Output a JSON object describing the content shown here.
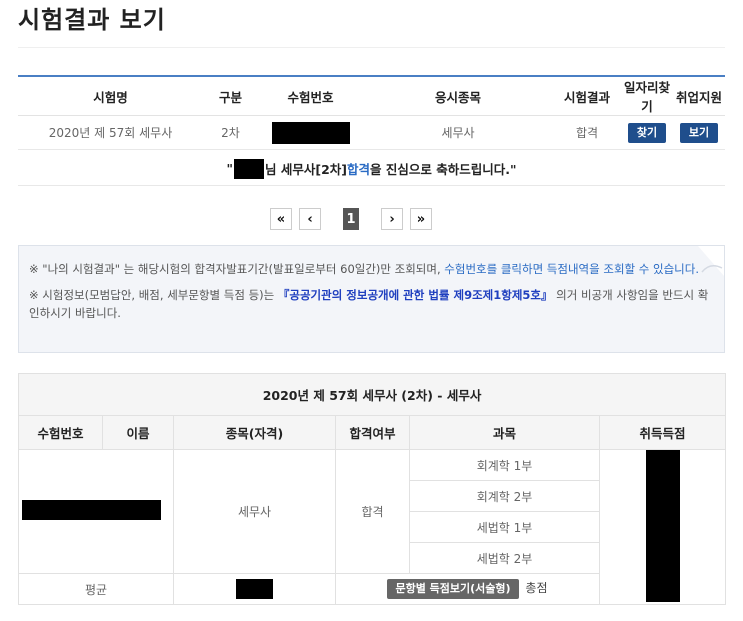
{
  "page": {
    "title": "시험결과 보기"
  },
  "results": {
    "columns": [
      "시험명",
      "구분",
      "수험번호",
      "응시종목",
      "시험결과",
      "일자리찾기",
      "취업지원"
    ],
    "row": {
      "exam_name": "2020년 제 57회 세무사",
      "stage": "2차",
      "category": "세무사",
      "result": "합격",
      "job_search_btn": "찾기",
      "employment_btn": "보기"
    },
    "congrats": {
      "quote_open": "\"",
      "suffix_a": "님 세무사[2차] ",
      "pass_word": "합격",
      "suffix_b": "을 진심으로 축하드립니다.\""
    }
  },
  "pagination": {
    "first": "«",
    "prev": "‹",
    "current": "1",
    "next": "›",
    "last": "»"
  },
  "notice": {
    "line1_a": "※ \"나의 시험결과\" 는 해당시험의 합격자발표기간(발표일로부터 60일간)만 조회되며, ",
    "line1_link": "수험번호를 클릭하면 득점내역을 조회할 수 있습니다.",
    "line2_a": "※ 시험정보(모범답안, 배점, 세부문항별 득점 등)는 ",
    "line2_link": "『공공기관의 정보공개에 관한 법률 제9조제1항제5호』",
    "line2_b": " 의거 비공개 사항임을 반드시 확인하시기 바랍니다."
  },
  "detail": {
    "caption": "2020년 제 57회 세무사 (2차) - 세무사",
    "columns": [
      "수험번호",
      "이름",
      "종목(자격)",
      "합격여부",
      "과목",
      "취득득점"
    ],
    "category": "세무사",
    "pass": "합격",
    "subjects": [
      "회계학 1부",
      "회계학 2부",
      "세법학 1부",
      "세법학 2부"
    ],
    "avg_label": "평균",
    "score_button": "문항별 득점보기(서술형)",
    "total_label": "총점"
  }
}
